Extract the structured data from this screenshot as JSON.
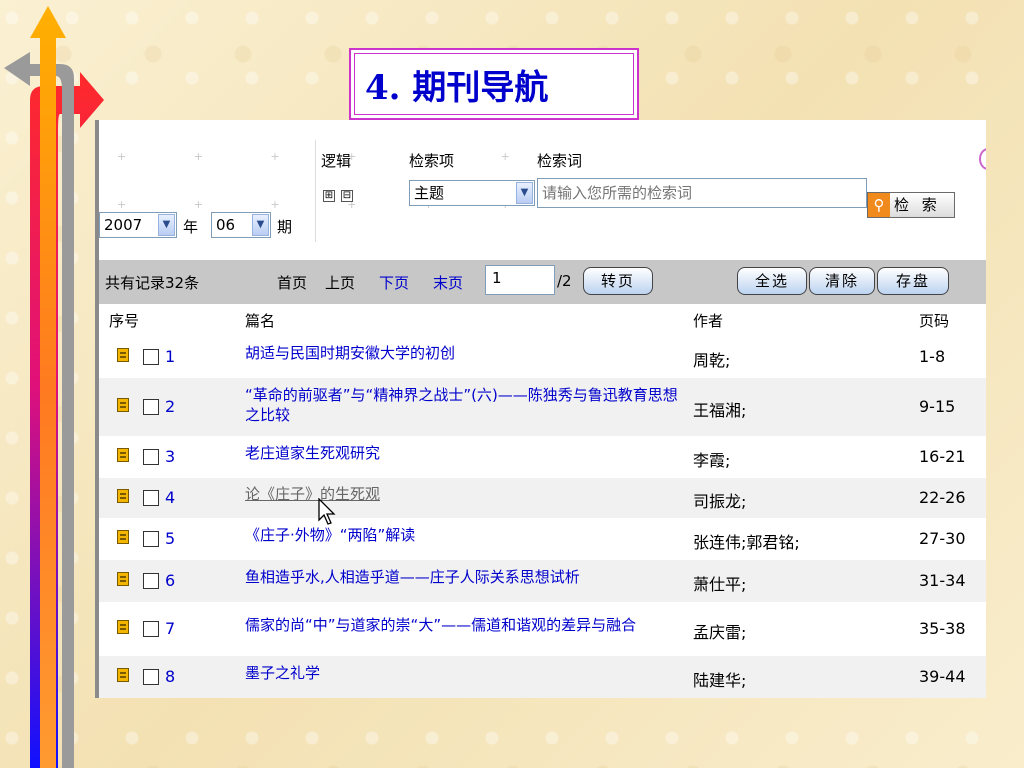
{
  "slide": {
    "title": "4. 期刊导航"
  },
  "toolbar": {
    "logic_label": "逻辑",
    "field_label": "检索项",
    "term_label": "检索词",
    "field_value": "主题",
    "search_placeholder": "请输入您所需的检索词",
    "search_button": "检 索",
    "year_value": "2007",
    "year_label": "年",
    "issue_value": "06",
    "issue_label": "期",
    "expand_icon": "⊞",
    "collapse_icon": "⊟"
  },
  "pager": {
    "total": "共有记录32条",
    "first": "首页",
    "prev": "上页",
    "next": "下页",
    "last": "末页",
    "page_value": "1",
    "page_total": "/2",
    "goto": "转页",
    "select_all": "全选",
    "clear": "清除",
    "save": "存盘"
  },
  "table": {
    "headers": {
      "no": "序号",
      "title": "篇名",
      "author": "作者",
      "pages": "页码"
    },
    "rows": [
      {
        "no": "1",
        "title": "胡适与民国时期安徽大学的初创",
        "author": "周乾;",
        "pages": "1-8"
      },
      {
        "no": "2",
        "title": "“革命的前驱者”与“精神界之战士”(六)——陈独秀与鲁迅教育思想之比较",
        "author": "王福湘;",
        "pages": "9-15"
      },
      {
        "no": "3",
        "title": "老庄道家生死观研究",
        "author": "李霞;",
        "pages": "16-21"
      },
      {
        "no": "4",
        "title": "论《庄子》的生死观",
        "author": "司振龙;",
        "pages": "22-26"
      },
      {
        "no": "5",
        "title": "《庄子·外物》“两陷”解读",
        "author": "张连伟;郭君铭;",
        "pages": "27-30"
      },
      {
        "no": "6",
        "title": "鱼相造乎水,人相造乎道——庄子人际关系思想试析",
        "author": "萧仕平;",
        "pages": "31-34"
      },
      {
        "no": "7",
        "title": "儒家的尚“中”与道家的崇“大”——儒道和谐观的差异与融合",
        "author": "孟庆雷;",
        "pages": "35-38"
      },
      {
        "no": "8",
        "title": "墨子之礼学",
        "author": "陆建华;",
        "pages": "39-44"
      }
    ]
  },
  "colors": {
    "link": "#0000cc",
    "title_border": "#cc33cc",
    "pager_bg": "#c7c7c7"
  }
}
